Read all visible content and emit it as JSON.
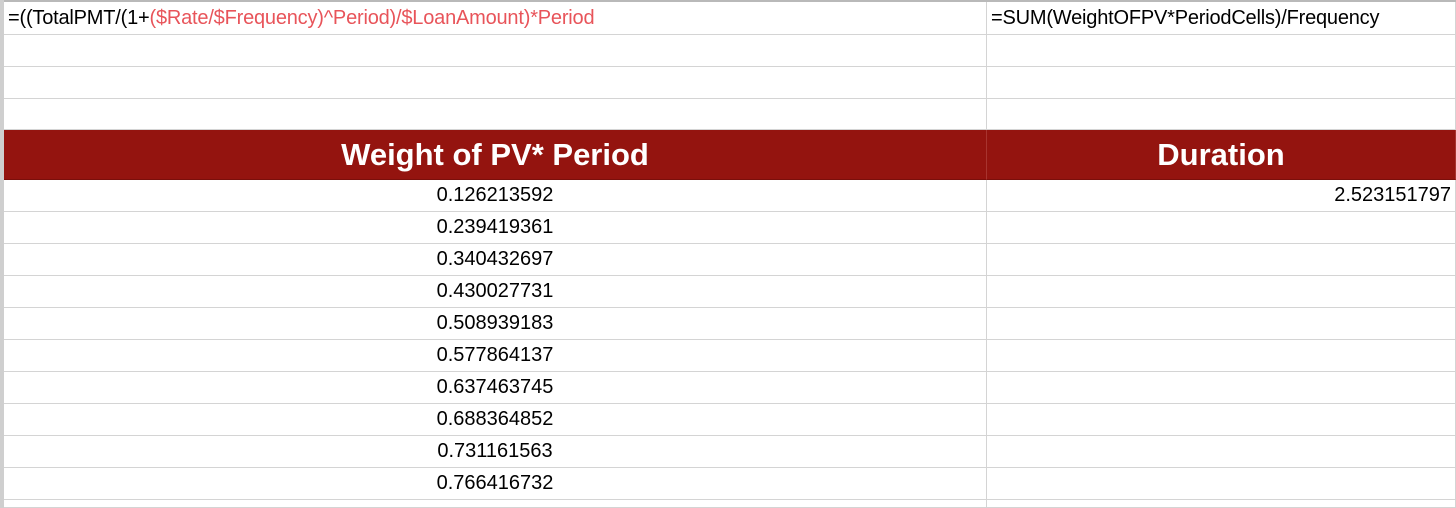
{
  "formula_row": {
    "left_formula_prefix": "=((TotalPMT/(1+",
    "left_formula_highlight_1": "($Rate/$Frequency)",
    "left_formula_middle": "^Period)/",
    "left_formula_highlight_2": "$LoanAmount)",
    "left_formula_suffix": "*Period",
    "right_formula": "=SUM(WeightOFPV*PeriodCells)/Frequency"
  },
  "colors": {
    "header_background": "#94140f",
    "formula_reference": "#e8545a"
  },
  "table": {
    "headers": [
      "Weight of PV* Period",
      "Duration"
    ],
    "weight_values": [
      "0.126213592",
      "0.239419361",
      "0.340432697",
      "0.430027731",
      "0.508939183",
      "0.577864137",
      "0.637463745",
      "0.688364852",
      "0.731161563",
      "0.766416732"
    ],
    "duration_value": "2.523151797"
  }
}
